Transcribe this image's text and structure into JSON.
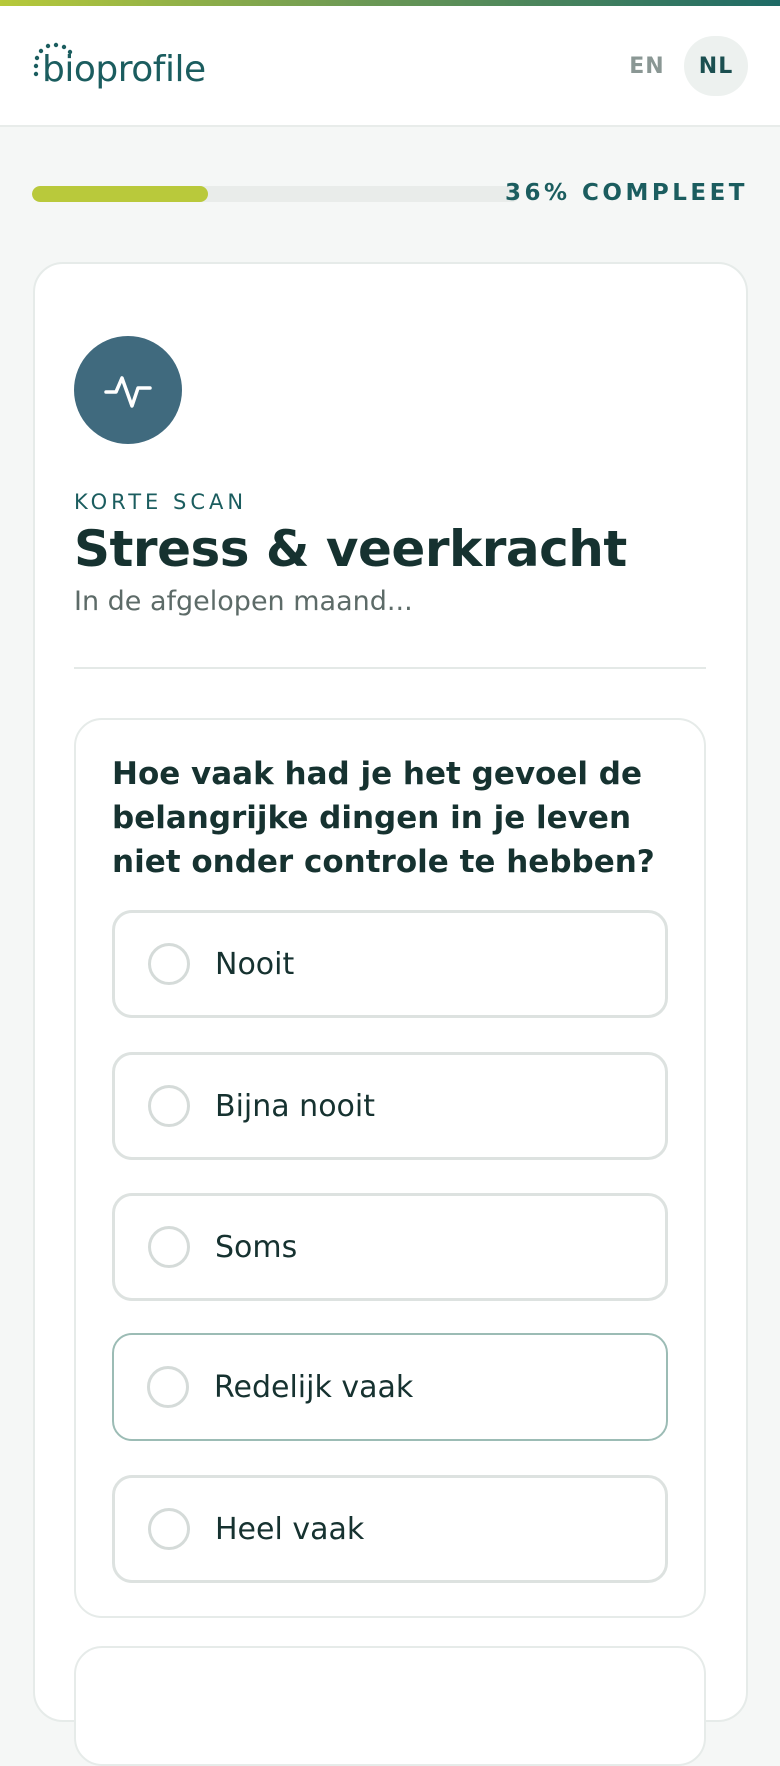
{
  "header": {
    "logo_text": "bioprofile",
    "languages": [
      {
        "code": "EN",
        "active": false
      },
      {
        "code": "NL",
        "active": true
      }
    ]
  },
  "progress": {
    "percent": 36,
    "label": "36% COMPLEET"
  },
  "section": {
    "icon": "activity-pulse-icon",
    "eyebrow": "KORTE SCAN",
    "title": "Stress & veerkracht",
    "subtitle": "In de afgelopen maand..."
  },
  "question": {
    "text": "Hoe vaak had je het gevoel de belangrijke dingen in je leven niet onder controle te hebben?",
    "options": [
      {
        "label": "Nooit",
        "selected": false
      },
      {
        "label": "Bijna nooit",
        "selected": false
      },
      {
        "label": "Soms",
        "selected": false
      },
      {
        "label": "Redelijk vaak",
        "selected": false
      },
      {
        "label": "Heel vaak",
        "selected": false
      }
    ]
  },
  "colors": {
    "accent_lime": "#b9c93b",
    "brand_teal": "#1b5d5f",
    "icon_bg": "#406a7e"
  }
}
